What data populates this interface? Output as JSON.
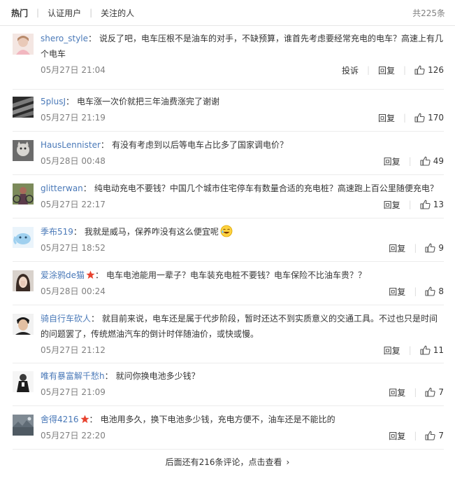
{
  "tabs": {
    "hot": "热门",
    "verified": "认证用户",
    "following": "关注的人"
  },
  "total": "共225条",
  "actions": {
    "report": "投诉",
    "reply": "回复"
  },
  "comments": [
    {
      "user": "shero_style",
      "text": "说反了吧，电车压根不是油车的对手，不缺预算，谁首先考虑要经常充电的电车？高速上有几个电车",
      "time": "05月27日 21:04",
      "likes": "126",
      "badge": false,
      "emoji": false,
      "report": true
    },
    {
      "user": "5plusJ",
      "text": "电车涨一次价就把三年油费涨完了谢谢",
      "time": "05月27日 21:19",
      "likes": "170",
      "badge": false,
      "emoji": false,
      "report": false
    },
    {
      "user": "HausLennister",
      "text": "有没有考虑到以后等电车占比多了国家调电价？",
      "time": "05月28日 00:48",
      "likes": "49",
      "badge": false,
      "emoji": false,
      "report": false
    },
    {
      "user": "glitterwan",
      "text": "纯电动充电不要钱？中国几个城市住宅停车有数量合适的充电桩？高速跑上百公里随便充电？",
      "time": "05月27日 22:17",
      "likes": "13",
      "badge": false,
      "emoji": false,
      "report": false
    },
    {
      "user": "季布519",
      "text": "我就是威马，保养咋没有这么便宜呢",
      "time": "05月27日 18:52",
      "likes": "9",
      "badge": false,
      "emoji": true,
      "report": false
    },
    {
      "user": "爱涂鸦de猫",
      "text": "电车电池能用一辈子？电车装充电桩不要钱？电车保险不比油车贵？？",
      "time": "05月28日 00:24",
      "likes": "8",
      "badge": true,
      "emoji": false,
      "report": false
    },
    {
      "user": "骑自行车砍人",
      "text": "就目前来说，电车还是属于代步阶段，暂时还达不到实质意义的交通工具。不过也只是时间的问题罢了，传统燃油汽车的倒计时伴随油价，或快或慢。",
      "time": "05月27日 21:12",
      "likes": "11",
      "badge": false,
      "emoji": false,
      "report": false
    },
    {
      "user": "唯有暴富解千愁h",
      "text": "就问你换电池多少钱？",
      "time": "05月27日 21:09",
      "likes": "7",
      "badge": false,
      "emoji": false,
      "report": false
    },
    {
      "user": "舍得4216",
      "text": "电池用多久，换下电池多少钱，充电方便不，油车还是不能比的",
      "time": "05月27日 22:20",
      "likes": "7",
      "badge": true,
      "emoji": false,
      "report": false
    }
  ],
  "more": "后面还有216条评论，点击查看",
  "colors": {
    "link": "#4a79b8",
    "badge": "#e8432f",
    "divider": "#ececec"
  }
}
